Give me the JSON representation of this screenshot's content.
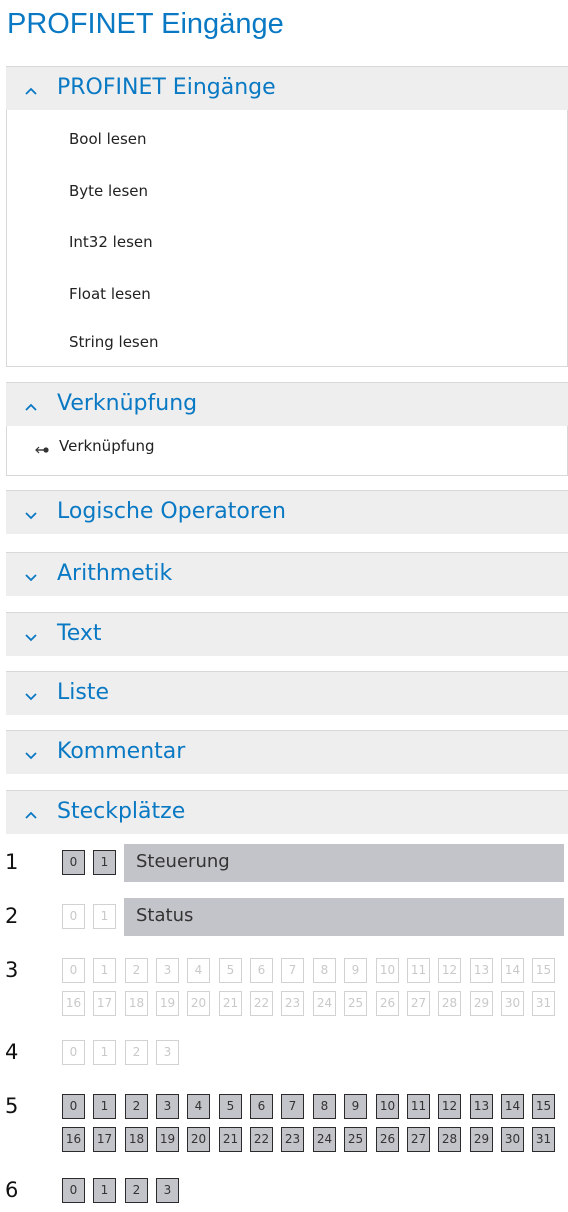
{
  "page_title": "PROFINET Eingänge",
  "sections": {
    "profinet": {
      "title": "PROFINET Eingänge",
      "expanded": true,
      "items": [
        "Bool lesen",
        "Byte lesen",
        "Int32 lesen",
        "Float lesen",
        "String lesen"
      ]
    },
    "verknuepfung": {
      "title": "Verknüpfung",
      "expanded": true,
      "items": [
        "Verknüpfung"
      ]
    },
    "logische": {
      "title": "Logische Operatoren",
      "expanded": false
    },
    "arithmetik": {
      "title": "Arithmetik",
      "expanded": false
    },
    "text": {
      "title": "Text",
      "expanded": false
    },
    "liste": {
      "title": "Liste",
      "expanded": false
    },
    "kommentar": {
      "title": "Kommentar",
      "expanded": false
    },
    "steckplaetze": {
      "title": "Steckplätze",
      "expanded": true
    }
  },
  "slots": [
    {
      "number": "1",
      "name": "Steuerung",
      "active": true,
      "rows": [
        [
          "0",
          "1"
        ]
      ]
    },
    {
      "number": "2",
      "name": "Status",
      "active": false,
      "rows": [
        [
          "0",
          "1"
        ]
      ]
    },
    {
      "number": "3",
      "name": "",
      "active": false,
      "rows": [
        [
          "0",
          "1",
          "2",
          "3",
          "4",
          "5",
          "6",
          "7",
          "8",
          "9",
          "10",
          "11",
          "12",
          "13",
          "14",
          "15"
        ],
        [
          "16",
          "17",
          "18",
          "19",
          "20",
          "21",
          "22",
          "23",
          "24",
          "25",
          "26",
          "27",
          "28",
          "29",
          "30",
          "31"
        ]
      ]
    },
    {
      "number": "4",
      "name": "",
      "active": false,
      "rows": [
        [
          "0",
          "1",
          "2",
          "3"
        ]
      ]
    },
    {
      "number": "5",
      "name": "",
      "active": true,
      "rows": [
        [
          "0",
          "1",
          "2",
          "3",
          "4",
          "5",
          "6",
          "7",
          "8",
          "9",
          "10",
          "11",
          "12",
          "13",
          "14",
          "15"
        ],
        [
          "16",
          "17",
          "18",
          "19",
          "20",
          "21",
          "22",
          "23",
          "24",
          "25",
          "26",
          "27",
          "28",
          "29",
          "30",
          "31"
        ]
      ]
    },
    {
      "number": "6",
      "name": "",
      "active": true,
      "rows": [
        [
          "0",
          "1",
          "2",
          "3"
        ]
      ]
    }
  ],
  "colors": {
    "accent": "#0a79c4",
    "header_bg": "#eeeeee",
    "active_box": "#c3c4c9"
  }
}
